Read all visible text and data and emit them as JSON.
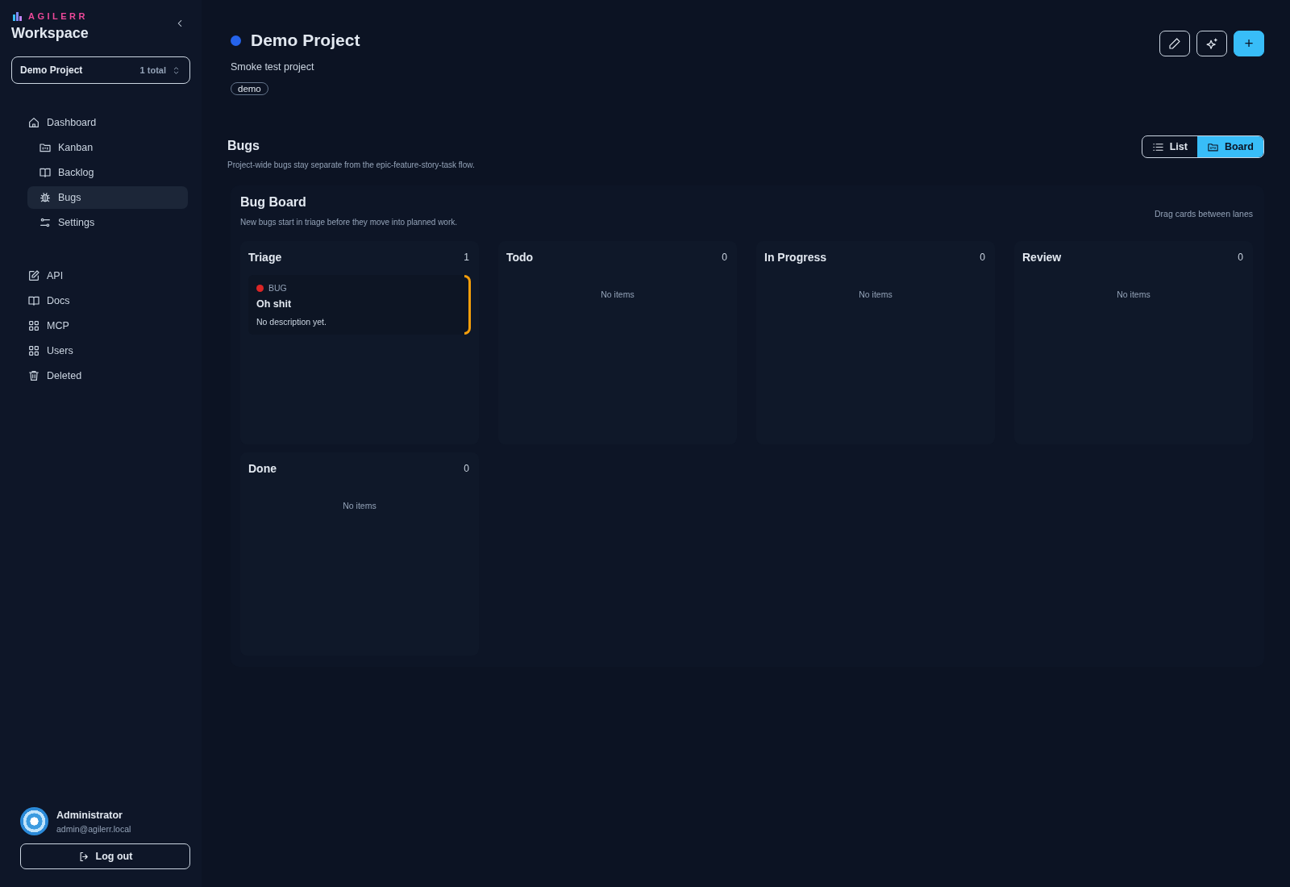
{
  "sidebar": {
    "brand": "AGILERR",
    "title": "Workspace",
    "project_picker": {
      "name": "Demo Project",
      "count": "1 total"
    },
    "nav": [
      {
        "label": "Dashboard",
        "selected": false,
        "children": [
          {
            "label": "Kanban",
            "selected": false
          },
          {
            "label": "Backlog",
            "selected": false
          },
          {
            "label": "Bugs",
            "selected": true
          },
          {
            "label": "Settings",
            "selected": false
          }
        ]
      }
    ],
    "links": [
      {
        "label": "API",
        "selected": false
      },
      {
        "label": "Docs",
        "selected": false
      },
      {
        "label": "MCP",
        "selected": false
      },
      {
        "label": "Users",
        "selected": false
      },
      {
        "label": "Deleted",
        "selected": false
      }
    ],
    "user": {
      "name": "Administrator",
      "email": "admin@agilerr.local"
    },
    "logout": "Log out"
  },
  "header": {
    "title": "Demo Project",
    "color": "#2563eb",
    "description": "Smoke test project",
    "tags": [
      "demo"
    ],
    "add_button": "+"
  },
  "section": {
    "title": "Bugs",
    "subtitle": "Project-wide bugs stay separate from the epic-feature-story-task flow.",
    "views": [
      {
        "label": "List",
        "selected": false
      },
      {
        "label": "Board",
        "selected": true
      }
    ]
  },
  "board": {
    "title": "Bug Board",
    "subtitle": "New bugs start in triage before they move into planned work.",
    "hint": "Drag cards between lanes",
    "lanes": [
      {
        "name": "Triage",
        "count": "1",
        "cards": [
          {
            "type": "BUG",
            "color": "#dc2626",
            "accent": {
              "color": "#f59e0b"
            },
            "title": "Oh shit",
            "description": "No description yet."
          }
        ]
      },
      {
        "name": "Todo",
        "count": "0",
        "empty": "No items"
      },
      {
        "name": "In Progress",
        "count": "0",
        "empty": "No items"
      },
      {
        "name": "Review",
        "count": "0",
        "empty": "No items"
      },
      {
        "name": "Done",
        "count": "0",
        "empty": "No items"
      }
    ]
  }
}
